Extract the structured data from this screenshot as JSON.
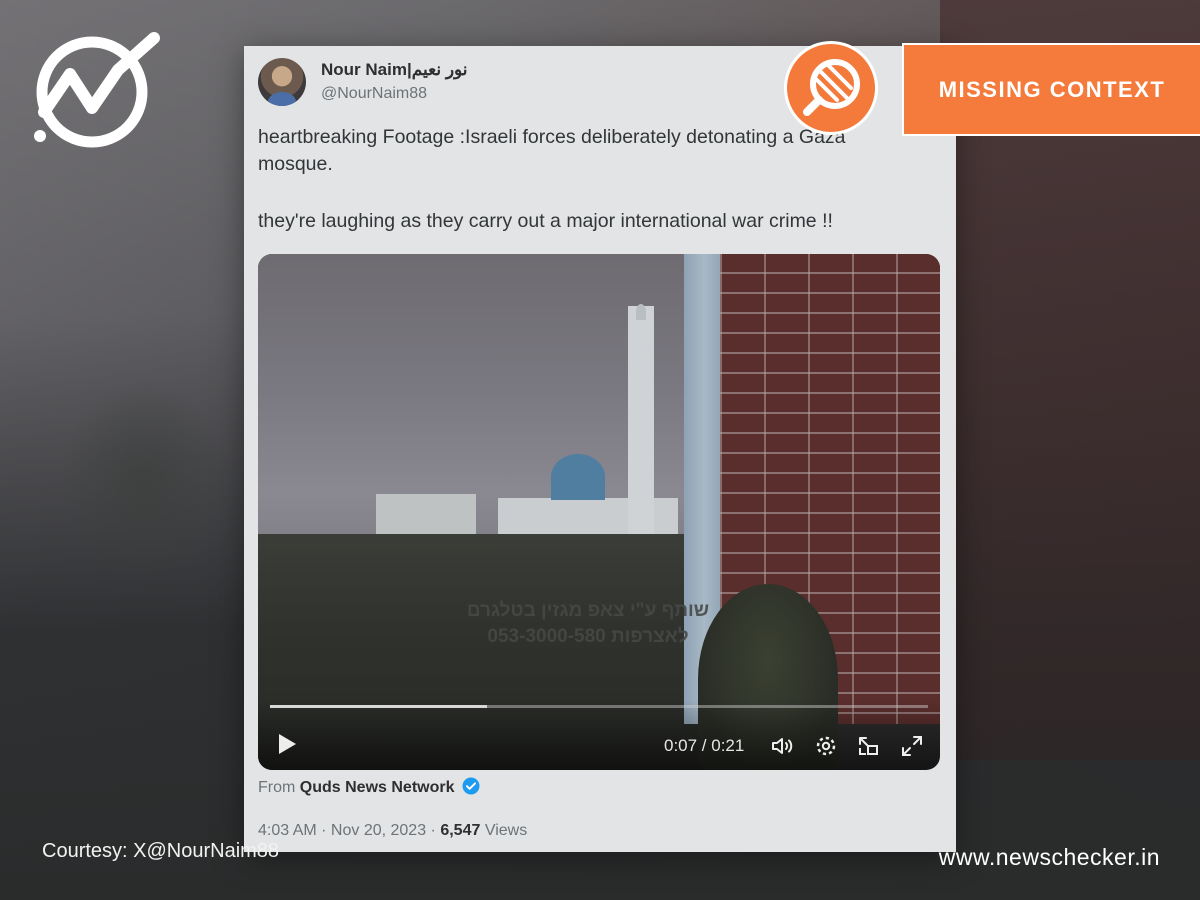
{
  "tweet": {
    "display_name": "Nour Naim|نور نعيم",
    "handle": "@NourNaim88",
    "text_line1": "heartbreaking Footage :Israeli forces deliberately detonating a Gaza mosque.",
    "text_line2": "they're laughing as they carry out a major international war crime !!",
    "video": {
      "overlay_line1": "שותף ע\"י צאפ מגזין בטלגרם",
      "overlay_line2": "053-3000-580 לאצרפות",
      "time": "0:07 / 0:21",
      "progress": 0.33,
      "icons": [
        "play-icon",
        "volume-icon",
        "settings-icon",
        "pip-icon",
        "fullscreen-icon"
      ]
    },
    "from_prefix": "From",
    "source": "Quds News Network",
    "time": "4:03 AM · Nov 20, 2023 · ",
    "views": "6,547",
    "views_label": "Views"
  },
  "badge": {
    "label": "MISSING CONTEXT",
    "color": "#f47b3b",
    "icon": "magnifier-icon"
  },
  "logo": {
    "icon": "newschecker-logo-icon"
  },
  "footer": {
    "courtesy": "Courtesy: X@NourNaim88",
    "site": "www.newschecker.in"
  }
}
